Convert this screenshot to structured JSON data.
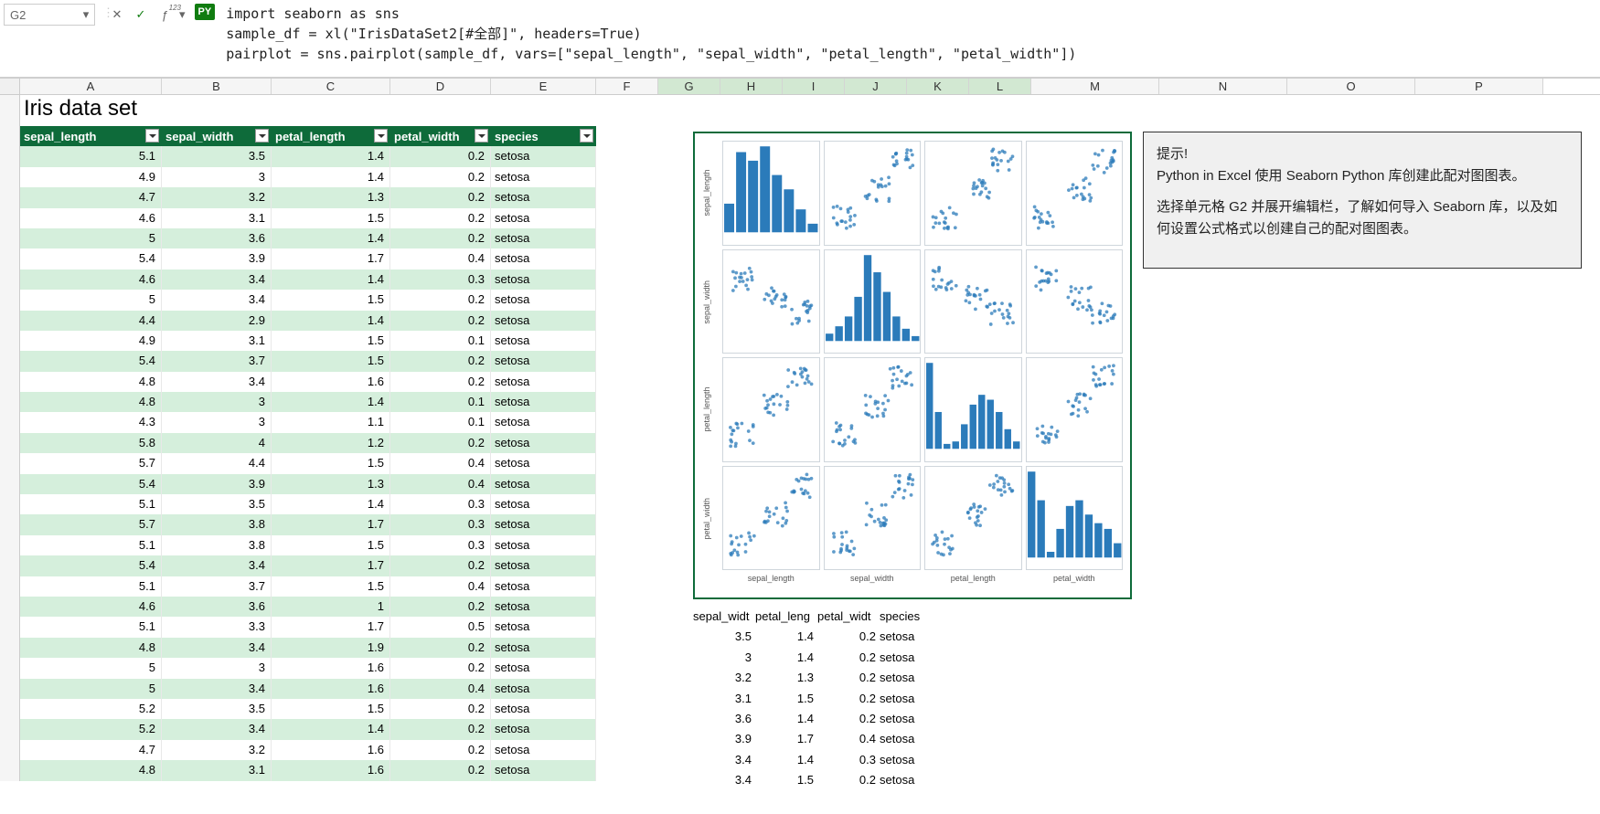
{
  "name_box": "G2",
  "formula_lines": [
    "import seaborn as sns",
    "sample_df = xl(\"IrisDataSet2[#全部]\", headers=True)",
    "pairplot = sns.pairplot(sample_df, vars=[\"sepal_length\", \"sepal_width\", \"petal_length\", \"petal_width\"])"
  ],
  "py_badge": "PY",
  "columns": [
    "A",
    "B",
    "C",
    "D",
    "E",
    "F",
    "G",
    "H",
    "I",
    "J",
    "K",
    "L",
    "M",
    "N",
    "O",
    "P"
  ],
  "active_cols": [
    "G",
    "H",
    "I",
    "J",
    "K",
    "L"
  ],
  "title": "Iris data set",
  "iris_headers": [
    "sepal_length",
    "sepal_width",
    "petal_length",
    "petal_width",
    "species"
  ],
  "iris_rows": [
    [
      5.1,
      3.5,
      1.4,
      0.2,
      "setosa"
    ],
    [
      4.9,
      3,
      1.4,
      0.2,
      "setosa"
    ],
    [
      4.7,
      3.2,
      1.3,
      0.2,
      "setosa"
    ],
    [
      4.6,
      3.1,
      1.5,
      0.2,
      "setosa"
    ],
    [
      5,
      3.6,
      1.4,
      0.2,
      "setosa"
    ],
    [
      5.4,
      3.9,
      1.7,
      0.4,
      "setosa"
    ],
    [
      4.6,
      3.4,
      1.4,
      0.3,
      "setosa"
    ],
    [
      5,
      3.4,
      1.5,
      0.2,
      "setosa"
    ],
    [
      4.4,
      2.9,
      1.4,
      0.2,
      "setosa"
    ],
    [
      4.9,
      3.1,
      1.5,
      0.1,
      "setosa"
    ],
    [
      5.4,
      3.7,
      1.5,
      0.2,
      "setosa"
    ],
    [
      4.8,
      3.4,
      1.6,
      0.2,
      "setosa"
    ],
    [
      4.8,
      3,
      1.4,
      0.1,
      "setosa"
    ],
    [
      4.3,
      3,
      1.1,
      0.1,
      "setosa"
    ],
    [
      5.8,
      4,
      1.2,
      0.2,
      "setosa"
    ],
    [
      5.7,
      4.4,
      1.5,
      0.4,
      "setosa"
    ],
    [
      5.4,
      3.9,
      1.3,
      0.4,
      "setosa"
    ],
    [
      5.1,
      3.5,
      1.4,
      0.3,
      "setosa"
    ],
    [
      5.7,
      3.8,
      1.7,
      0.3,
      "setosa"
    ],
    [
      5.1,
      3.8,
      1.5,
      0.3,
      "setosa"
    ],
    [
      5.4,
      3.4,
      1.7,
      0.2,
      "setosa"
    ],
    [
      5.1,
      3.7,
      1.5,
      0.4,
      "setosa"
    ],
    [
      4.6,
      3.6,
      1,
      0.2,
      "setosa"
    ],
    [
      5.1,
      3.3,
      1.7,
      0.5,
      "setosa"
    ],
    [
      4.8,
      3.4,
      1.9,
      0.2,
      "setosa"
    ],
    [
      5,
      3,
      1.6,
      0.2,
      "setosa"
    ],
    [
      5,
      3.4,
      1.6,
      0.4,
      "setosa"
    ],
    [
      5.2,
      3.5,
      1.5,
      0.2,
      "setosa"
    ],
    [
      5.2,
      3.4,
      1.4,
      0.2,
      "setosa"
    ],
    [
      4.7,
      3.2,
      1.6,
      0.2,
      "setosa"
    ],
    [
      4.8,
      3.1,
      1.6,
      0.2,
      "setosa"
    ]
  ],
  "tip": {
    "title": "提示!",
    "line1": "Python in Excel 使用 Seaborn Python 库创建此配对图图表。",
    "line2": "选择单元格 G2 并展开编辑栏，了解如何导入 Seaborn 库，以及如何设置公式格式以创建自己的配对图图表。"
  },
  "mini_headers": [
    "sepal_widt",
    "petal_leng",
    "petal_widt",
    "species"
  ],
  "mini_rows": [
    [
      3.5,
      1.4,
      0.2,
      "setosa"
    ],
    [
      3,
      1.4,
      0.2,
      "setosa"
    ],
    [
      3.2,
      1.3,
      0.2,
      "setosa"
    ],
    [
      3.1,
      1.5,
      0.2,
      "setosa"
    ],
    [
      3.6,
      1.4,
      0.2,
      "setosa"
    ],
    [
      3.9,
      1.7,
      0.4,
      "setosa"
    ],
    [
      3.4,
      1.4,
      0.3,
      "setosa"
    ],
    [
      3.4,
      1.5,
      0.2,
      "setosa"
    ]
  ],
  "chart_data": {
    "type": "pairplot",
    "vars": [
      "sepal_length",
      "sepal_width",
      "petal_length",
      "petal_width"
    ],
    "ranges": {
      "sepal_length": [
        4,
        8
      ],
      "sepal_width": [
        2,
        4.5
      ],
      "petal_length": [
        1,
        7
      ],
      "petal_width": [
        0,
        2.5
      ]
    },
    "histograms": {
      "sepal_length": {
        "bins": [
          4.5,
          5,
          5.5,
          6,
          6.5,
          7,
          7.5,
          8
        ],
        "counts": [
          10,
          28,
          25,
          30,
          20,
          15,
          8,
          3
        ]
      },
      "sepal_width": {
        "bins": [
          2.0,
          2.25,
          2.5,
          2.75,
          3.0,
          3.25,
          3.5,
          3.75,
          4.0,
          4.25
        ],
        "counts": [
          3,
          6,
          10,
          18,
          35,
          28,
          20,
          10,
          5,
          2
        ]
      },
      "petal_length": {
        "bins": [
          1,
          1.5,
          2,
          3,
          3.5,
          4,
          4.5,
          5,
          5.5,
          6,
          6.5
        ],
        "counts": [
          35,
          15,
          2,
          3,
          10,
          18,
          22,
          20,
          15,
          8,
          3
        ]
      },
      "petal_width": {
        "bins": [
          0,
          0.25,
          0.5,
          1.0,
          1.25,
          1.5,
          1.75,
          2.0,
          2.25,
          2.5
        ],
        "counts": [
          30,
          20,
          2,
          10,
          18,
          20,
          15,
          12,
          10,
          5
        ]
      }
    },
    "scatter_note": "off-diagonal cells are scatter plots of the corresponding variable pair using full iris dataset (150 pts, 3 species clusters)"
  }
}
